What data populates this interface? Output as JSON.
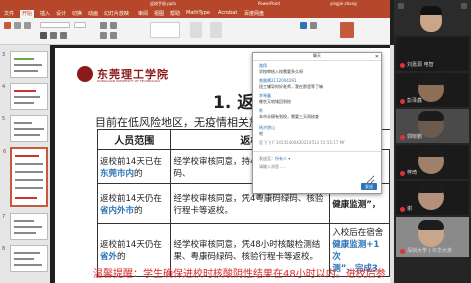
{
  "window": {
    "app": "PowerPoint",
    "file": "返校手册.pptx",
    "user": "yingjie zhang"
  },
  "ribbon": {
    "tabs": [
      "文件",
      "开始",
      "插入",
      "设计",
      "切换",
      "动画",
      "幻灯片放映",
      "审阅",
      "视图",
      "帮助",
      "MathType",
      "Acrobat",
      "百度网盘"
    ],
    "active_tab": "开始"
  },
  "thumbnails": {
    "numbers": [
      "3",
      "4",
      "5",
      "6",
      "7",
      "8"
    ],
    "selected": "6"
  },
  "slide": {
    "university_name": "东莞理工学院",
    "university_en": "DONGGUAN UNIVERSITY OF TECHNOLOGY",
    "title": "1. 返校",
    "subtitle": "目前在低风险地区，无疫情相关旅居",
    "table": {
      "headers": [
        "人员范围",
        "返校"
      ],
      "rows": [
        {
          "c1_pre": "返校前14天已在",
          "c1_hl": "东莞市内",
          "c1_post": "的",
          "c2": "经学校审核同意，持4证明、粤康码绿码、"
        },
        {
          "c1_pre": "返校前14天仍在",
          "c1_hl": "省内外市",
          "c1_post": "的",
          "c2": "经学校审核同意，凭4粤康码绿码、核验行程卡等返校。",
          "c3": "健康监测”，"
        },
        {
          "c1_pre": "返校前14天仍在",
          "c1_hl": "省外",
          "c1_post": "的",
          "c2": "经学校审核同意，凭48小时核酸检测结果、粤康码绿码、核验行程卡等返校。",
          "c3a": "入校后在宿舍",
          "c3b": "健康监测+1次",
          "c3c": "测”，完成3"
        }
      ]
    },
    "tip": "温馨提醒：学生确保进校时核酸阴性结果在48小时以内。进校后参"
  },
  "chat": {
    "title": "聊天",
    "messages": [
      {
        "name": "路翔",
        "text": "学校审核入校需要多久呀"
      },
      {
        "name": "曾晨曦2112004291",
        "text": "班工辅导你好老师，我在那里等了嘛"
      },
      {
        "name": "李琴鑫",
        "text": "哪些又地域回到校"
      },
      {
        "name": "陈",
        "text": "本市半模有到校，需要三天再核查"
      },
      {
        "name": "杨洪港山",
        "text": "哈"
      },
      {
        "name": "",
        "text": "医飞飞 F 14545400420210513 15:55:17 Mf"
      }
    ],
    "to_label": "发送至：",
    "to_value": "所有人 ▾",
    "placeholder": "请输入消息...",
    "send": "发送"
  },
  "meeting": {
    "participants": [
      {
        "name": "刘嘉源 电智"
      },
      {
        "name": "彭泽鑫"
      },
      {
        "name": "郭晓鹏"
      },
      {
        "name": "梓琦"
      },
      {
        "name": "谢"
      },
      {
        "name": "深圳大学 | 许华大弟"
      }
    ]
  }
}
